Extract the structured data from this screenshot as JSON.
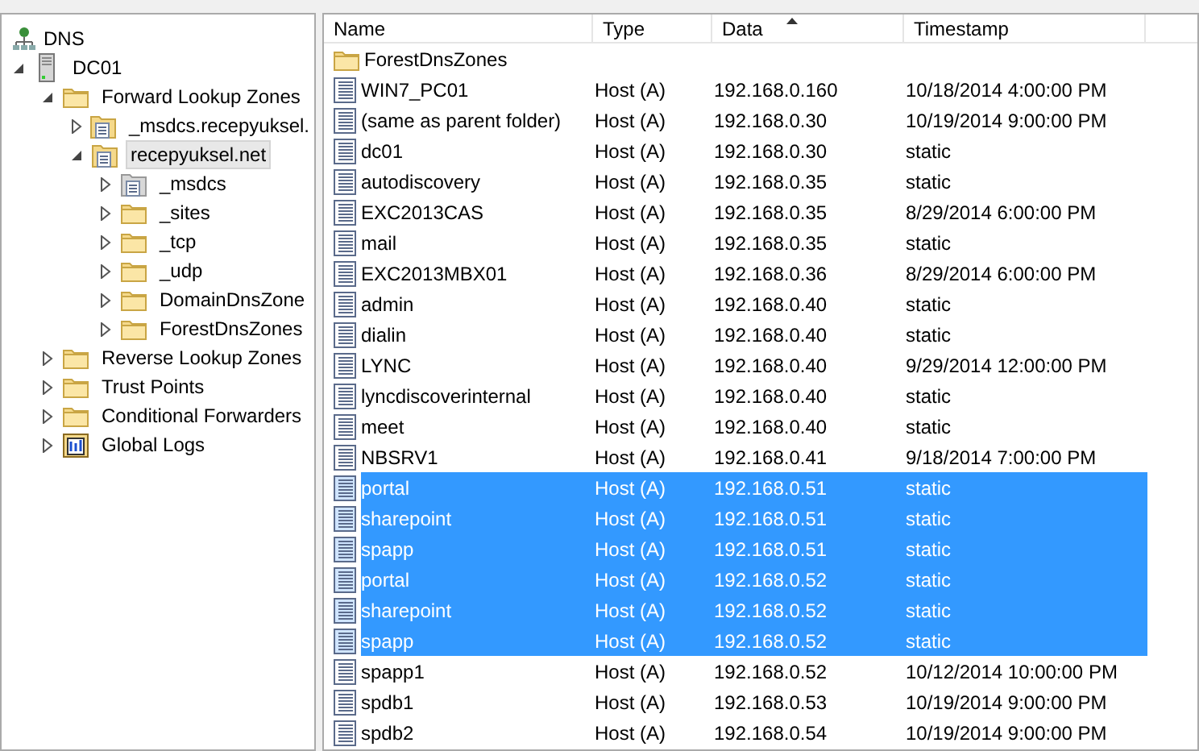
{
  "tree": {
    "label": "DNS",
    "children": [
      {
        "label": "DC01",
        "kind": "server",
        "expanded": true,
        "selected": false,
        "children": [
          {
            "label": "Forward Lookup Zones",
            "kind": "folder",
            "expanded": true,
            "selected": false,
            "children": [
              {
                "label": "_msdcs.recepyuksel.",
                "kind": "zone",
                "expanded": false,
                "selected": false
              },
              {
                "label": "recepyuksel.net",
                "kind": "zone",
                "expanded": true,
                "selected": true,
                "children": [
                  {
                    "label": "_msdcs",
                    "kind": "delegated",
                    "expanded": false,
                    "selected": false
                  },
                  {
                    "label": "_sites",
                    "kind": "folder",
                    "expanded": false,
                    "selected": false
                  },
                  {
                    "label": "_tcp",
                    "kind": "folder",
                    "expanded": false,
                    "selected": false
                  },
                  {
                    "label": "_udp",
                    "kind": "folder",
                    "expanded": false,
                    "selected": false
                  },
                  {
                    "label": "DomainDnsZone",
                    "kind": "folder",
                    "expanded": false,
                    "selected": false
                  },
                  {
                    "label": "ForestDnsZones",
                    "kind": "folder",
                    "expanded": false,
                    "selected": false
                  }
                ]
              }
            ]
          },
          {
            "label": "Reverse Lookup Zones",
            "kind": "folder",
            "expanded": false,
            "selected": false
          },
          {
            "label": "Trust Points",
            "kind": "folder",
            "expanded": false,
            "selected": false
          },
          {
            "label": "Conditional Forwarders",
            "kind": "folder",
            "expanded": false,
            "selected": false
          },
          {
            "label": "Global Logs",
            "kind": "log",
            "expanded": false,
            "selected": false
          }
        ]
      }
    ]
  },
  "table": {
    "columns": [
      {
        "label": "Name",
        "sorted": false
      },
      {
        "label": "Type",
        "sorted": false
      },
      {
        "label": "Data",
        "sorted": true
      },
      {
        "label": "Timestamp",
        "sorted": false
      }
    ],
    "rows": [
      {
        "kind": "folder",
        "name": "ForestDnsZones",
        "selected": false
      },
      {
        "kind": "record",
        "name": "WIN7_PC01",
        "type": "Host (A)",
        "data": "192.168.0.160",
        "timestamp": "10/18/2014 4:00:00 PM",
        "selected": false
      },
      {
        "kind": "record",
        "name": "(same as parent folder)",
        "type": "Host (A)",
        "data": "192.168.0.30",
        "timestamp": "10/19/2014 9:00:00 PM",
        "selected": false
      },
      {
        "kind": "record",
        "name": "dc01",
        "type": "Host (A)",
        "data": "192.168.0.30",
        "timestamp": "static",
        "selected": false
      },
      {
        "kind": "record",
        "name": "autodiscovery",
        "type": "Host (A)",
        "data": "192.168.0.35",
        "timestamp": "static",
        "selected": false
      },
      {
        "kind": "record",
        "name": "EXC2013CAS",
        "type": "Host (A)",
        "data": "192.168.0.35",
        "timestamp": "8/29/2014 6:00:00 PM",
        "selected": false
      },
      {
        "kind": "record",
        "name": "mail",
        "type": "Host (A)",
        "data": "192.168.0.35",
        "timestamp": "static",
        "selected": false
      },
      {
        "kind": "record",
        "name": "EXC2013MBX01",
        "type": "Host (A)",
        "data": "192.168.0.36",
        "timestamp": "8/29/2014 6:00:00 PM",
        "selected": false
      },
      {
        "kind": "record",
        "name": "admin",
        "type": "Host (A)",
        "data": "192.168.0.40",
        "timestamp": "static",
        "selected": false
      },
      {
        "kind": "record",
        "name": "dialin",
        "type": "Host (A)",
        "data": "192.168.0.40",
        "timestamp": "static",
        "selected": false
      },
      {
        "kind": "record",
        "name": "LYNC",
        "type": "Host (A)",
        "data": "192.168.0.40",
        "timestamp": "9/29/2014 12:00:00 PM",
        "selected": false
      },
      {
        "kind": "record",
        "name": "lyncdiscoverinternal",
        "type": "Host (A)",
        "data": "192.168.0.40",
        "timestamp": "static",
        "selected": false
      },
      {
        "kind": "record",
        "name": "meet",
        "type": "Host (A)",
        "data": "192.168.0.40",
        "timestamp": "static",
        "selected": false
      },
      {
        "kind": "record",
        "name": "NBSRV1",
        "type": "Host (A)",
        "data": "192.168.0.41",
        "timestamp": "9/18/2014 7:00:00 PM",
        "selected": false
      },
      {
        "kind": "record",
        "name": "portal",
        "type": "Host (A)",
        "data": "192.168.0.51",
        "timestamp": "static",
        "selected": true
      },
      {
        "kind": "record",
        "name": "sharepoint",
        "type": "Host (A)",
        "data": "192.168.0.51",
        "timestamp": "static",
        "selected": true
      },
      {
        "kind": "record",
        "name": "spapp",
        "type": "Host (A)",
        "data": "192.168.0.51",
        "timestamp": "static",
        "selected": true
      },
      {
        "kind": "record",
        "name": "portal",
        "type": "Host (A)",
        "data": "192.168.0.52",
        "timestamp": "static",
        "selected": true
      },
      {
        "kind": "record",
        "name": "sharepoint",
        "type": "Host (A)",
        "data": "192.168.0.52",
        "timestamp": "static",
        "selected": true
      },
      {
        "kind": "record",
        "name": "spapp",
        "type": "Host (A)",
        "data": "192.168.0.52",
        "timestamp": "static",
        "selected": true
      },
      {
        "kind": "record",
        "name": "spapp1",
        "type": "Host (A)",
        "data": "192.168.0.52",
        "timestamp": "10/12/2014 10:00:00 PM",
        "selected": false
      },
      {
        "kind": "record",
        "name": "spdb1",
        "type": "Host (A)",
        "data": "192.168.0.53",
        "timestamp": "10/19/2014 9:00:00 PM",
        "selected": false
      },
      {
        "kind": "record",
        "name": "spdb2",
        "type": "Host (A)",
        "data": "192.168.0.54",
        "timestamp": "10/19/2014 9:00:00 PM",
        "selected": false
      }
    ]
  }
}
